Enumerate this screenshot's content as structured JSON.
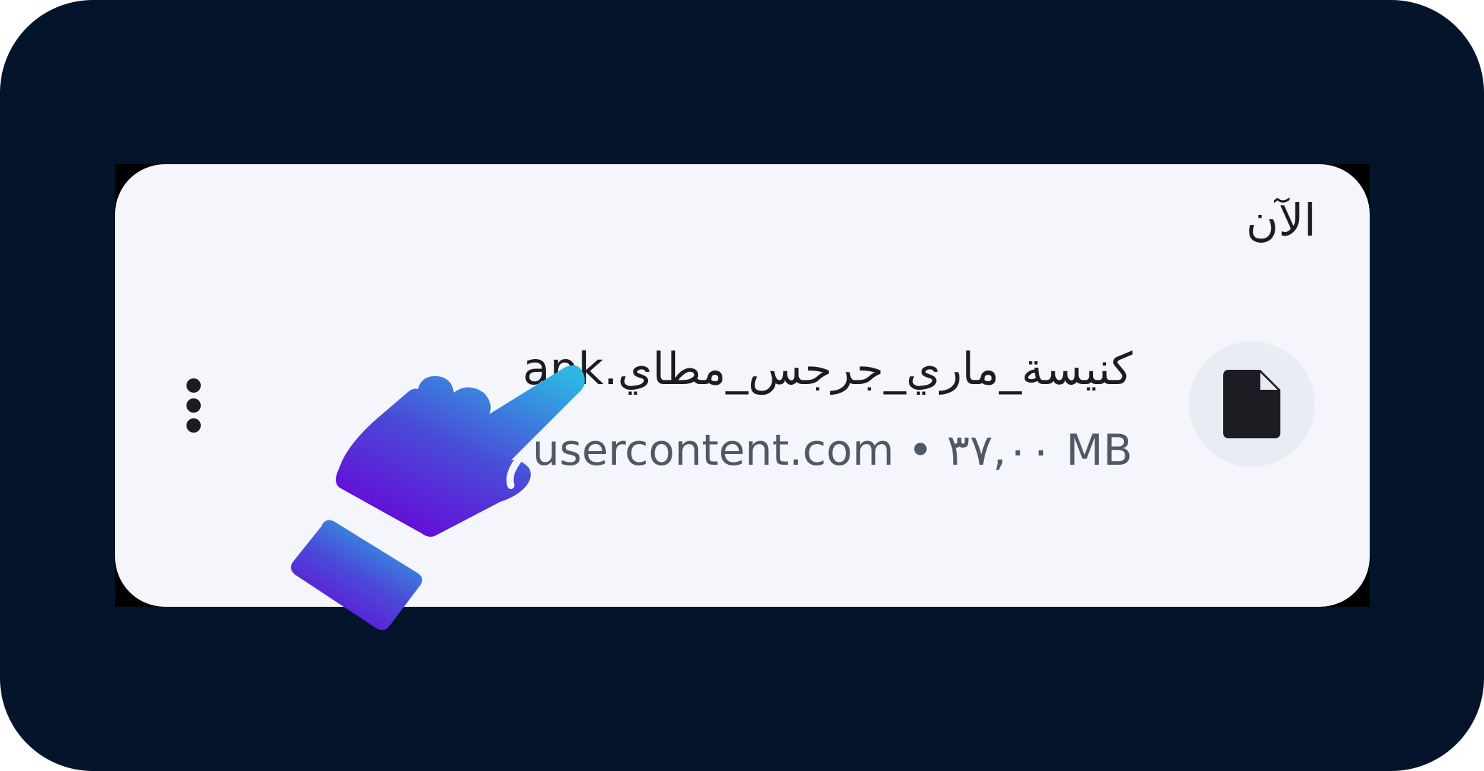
{
  "notification": {
    "time": "الآن",
    "file_name": "كنيسة_ماري_جرجس_مطاي.apk",
    "source": "usercontent.com",
    "separator": "•",
    "size": "٣٧,٠٠ MB"
  },
  "icons": {
    "file": "file-icon",
    "menu": "more-vertical-icon",
    "overlay": "pointing-hand-icon"
  },
  "colors": {
    "background": "#04152b",
    "card": "#f5f6fb",
    "hand_gradient_top": "#2db5e3",
    "hand_gradient_bottom": "#6a00d8"
  }
}
